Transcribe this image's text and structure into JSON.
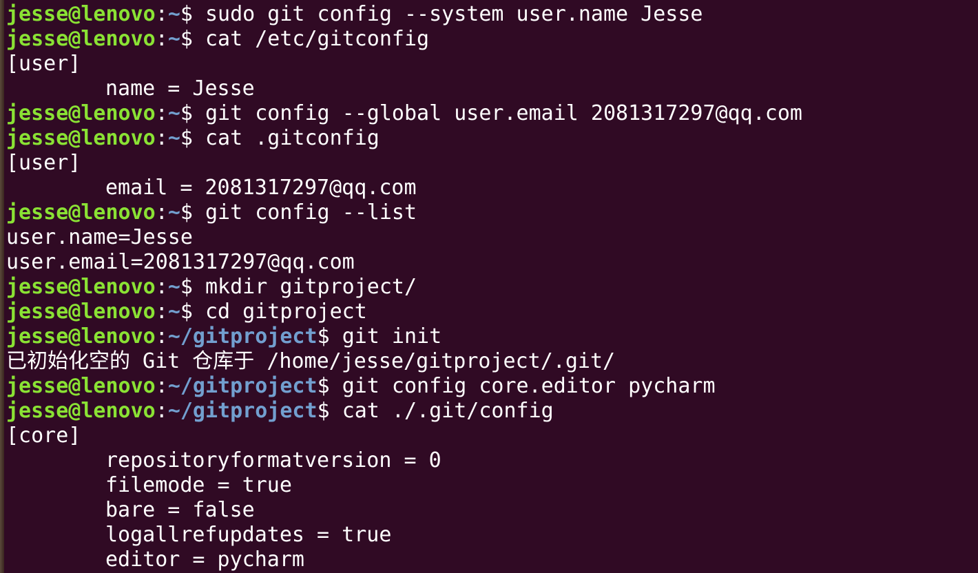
{
  "theme": {
    "background": "#300a24",
    "prompt_user_color": "#8ae234",
    "prompt_path_color": "#729fcf",
    "text_color": "#ffffff"
  },
  "prompt": {
    "userhost": "jesse@lenovo",
    "colon": ":",
    "dollar": "$ "
  },
  "lines": [
    {
      "type": "prompt",
      "path": "~",
      "command": "sudo git config --system user.name Jesse"
    },
    {
      "type": "prompt",
      "path": "~",
      "command": "cat /etc/gitconfig"
    },
    {
      "type": "output",
      "indent": false,
      "text": "[user]"
    },
    {
      "type": "output",
      "indent": true,
      "text": "name = Jesse"
    },
    {
      "type": "prompt",
      "path": "~",
      "command": "git config --global user.email 2081317297@qq.com"
    },
    {
      "type": "prompt",
      "path": "~",
      "command": "cat .gitconfig"
    },
    {
      "type": "output",
      "indent": false,
      "text": "[user]"
    },
    {
      "type": "output",
      "indent": true,
      "text": "email = 2081317297@qq.com"
    },
    {
      "type": "prompt",
      "path": "~",
      "command": "git config --list"
    },
    {
      "type": "output",
      "indent": false,
      "text": "user.name=Jesse"
    },
    {
      "type": "output",
      "indent": false,
      "text": "user.email=2081317297@qq.com"
    },
    {
      "type": "prompt",
      "path": "~",
      "command": "mkdir gitproject/"
    },
    {
      "type": "prompt",
      "path": "~",
      "command": "cd gitproject"
    },
    {
      "type": "prompt",
      "path": "~/gitproject",
      "command": "git init"
    },
    {
      "type": "output",
      "indent": false,
      "text": "已初始化空的 Git 仓库于 /home/jesse/gitproject/.git/"
    },
    {
      "type": "prompt",
      "path": "~/gitproject",
      "command": "git config core.editor pycharm"
    },
    {
      "type": "prompt",
      "path": "~/gitproject",
      "command": "cat ./.git/config"
    },
    {
      "type": "output",
      "indent": false,
      "text": "[core]"
    },
    {
      "type": "output",
      "indent": true,
      "text": "repositoryformatversion = 0"
    },
    {
      "type": "output",
      "indent": true,
      "text": "filemode = true"
    },
    {
      "type": "output",
      "indent": true,
      "text": "bare = false"
    },
    {
      "type": "output",
      "indent": true,
      "text": "logallrefupdates = true"
    },
    {
      "type": "output",
      "indent": true,
      "text": "editor = pycharm"
    }
  ]
}
